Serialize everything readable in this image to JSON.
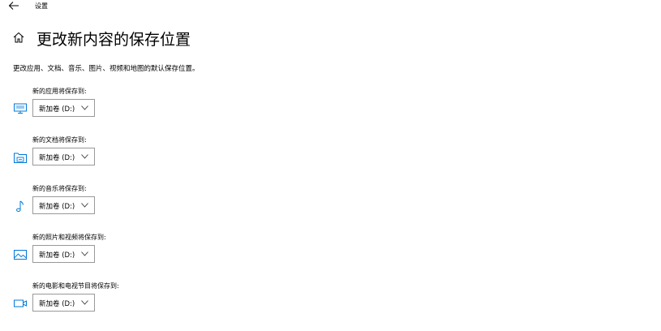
{
  "window": {
    "back_icon": "back-arrow-icon",
    "title": "设置"
  },
  "header": {
    "home_icon": "home-icon",
    "title": "更改新内容的保存位置"
  },
  "description": "更改应用、文档、音乐、图片、视频和地图的默认保存位置。",
  "settings": [
    {
      "label": "新的应用将保存到:",
      "icon": "monitor-icon",
      "value": "新加卷 (D:)"
    },
    {
      "label": "新的文档将保存到:",
      "icon": "document-drive-icon",
      "value": "新加卷 (D:)"
    },
    {
      "label": "新的音乐将保存到:",
      "icon": "music-note-icon",
      "value": "新加卷 (D:)"
    },
    {
      "label": "新的照片和视频将保存到:",
      "icon": "picture-icon",
      "value": "新加卷 (D:)"
    },
    {
      "label": "新的电影和电视节目将保存到:",
      "icon": "video-camera-icon",
      "value": "新加卷 (D:)"
    }
  ],
  "colors": {
    "accent": "#0078d7",
    "dropdown_border": "#999999",
    "text": "#000000",
    "background": "#ffffff"
  }
}
